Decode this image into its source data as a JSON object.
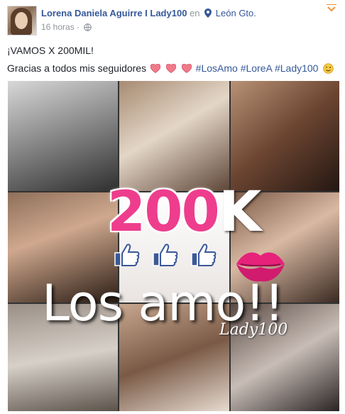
{
  "post": {
    "author": "Lorena Daniela Aguirre I Lady100",
    "connector": "en",
    "location": "León Gto.",
    "time": "16 horas",
    "separator": "·",
    "icons": {
      "location": "map-pin-icon",
      "privacy": "globe-icon",
      "menu": "chevron-down-icon"
    }
  },
  "message": {
    "line1": "¡VAMOS X 200MIL!",
    "line2_text": "Gracias a todos mis seguidores",
    "hashtags": [
      "#LosAmo",
      "#LoreA",
      "#Lady100"
    ],
    "emoji": [
      "heart-icon",
      "heart-icon",
      "heart-icon",
      "smiley-wink-icon"
    ]
  },
  "image": {
    "number_text": "200",
    "k_text": "K",
    "caption": "Los amo!!",
    "signature": "Lady100",
    "colors": {
      "pink": "#ee3d8d",
      "white": "#ffffff",
      "like_blue": "#3b5998"
    }
  },
  "colors": {
    "link": "#365899",
    "meta": "#90949c",
    "text": "#1d2129"
  }
}
